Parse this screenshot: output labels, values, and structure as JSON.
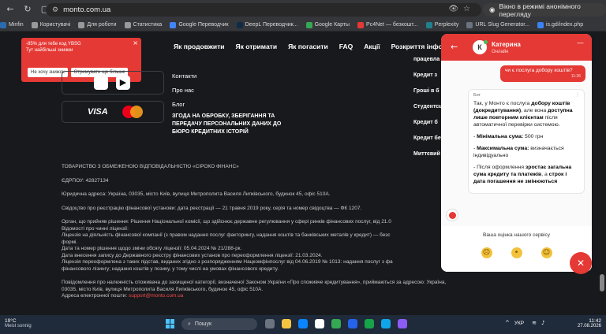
{
  "browser": {
    "url": "monto.com.ua",
    "incognito_label": "Вікно в режимі анонімного перегляду"
  },
  "bookmarks": [
    {
      "label": "Minfin",
      "color": "#2b6cb0"
    },
    {
      "label": "Користувачі",
      "color": "#999999"
    },
    {
      "label": "Для роботи",
      "color": "#999999"
    },
    {
      "label": "Статистика",
      "color": "#999999"
    },
    {
      "label": "Google Переводчик",
      "color": "#4285f4"
    },
    {
      "label": "DeepL Переводчик...",
      "color": "#0f2b46"
    },
    {
      "label": "Google Карты",
      "color": "#34a853"
    },
    {
      "label": "Pc4Net — безкошт...",
      "color": "#e53935"
    },
    {
      "label": "Perplexity",
      "color": "#20808d"
    },
    {
      "label": "URL Slug Generator...",
      "color": "#6b7280"
    },
    {
      "label": "is.gd/index.php",
      "color": "#3b82f6"
    }
  ],
  "nav": {
    "links": [
      "Як продовжити",
      "Як отримати",
      "Як погасити",
      "FAQ",
      "Акції",
      "Розкриття інформації"
    ]
  },
  "promo": {
    "line1": "-85% для тебе код YBSG",
    "line2": "Тут найбільші знижки",
    "decline": "Не хочу знижок",
    "accept": "Отримувати ще більше"
  },
  "footer": {
    "mid_links": [
      "Контакти",
      "Про нас",
      "Блог"
    ],
    "data_policy": "ЗГОДА НА ОБРОБКУ, ЗБЕРІГАННЯ ТА ПЕРЕДАЧУ ПЕРСОНАЛЬНИХ ДАНИХ ДО БЮРО КРЕДИТНИХ ІСТОРІЙ",
    "right_links": [
      "працевла",
      "Кредит з",
      "Гроші в б",
      "Студентсь",
      "Кредит б",
      "Кредит бе",
      "Миттєвий"
    ],
    "visa": "VISA"
  },
  "legal": {
    "company": "ТОВАРИСТВО З ОБМЕЖЕНОЮ ВІДПОВІДАЛЬНІСТЮ «СІРОКО ФІНАНС»",
    "edrpou": "ЄДРПОУ: 42827134",
    "address": "Юридична адреса: Україна, 03035, місто Київ, вулиця Митрополита Василя Липківського, будинок 45, офіс 510А.",
    "certificate": "Свідоцтво про реєстрацію фінансової установи: дата реєстрації — 21 травня 2019 року, серія та номер свідоцтва — ФК 1207.",
    "regulator": "Орган, що прийняв рішення: Рішення Національної комісії, що здійснює державне регулювання у сфері ринків фінансових послуг, від 21.0",
    "license_info": "Відомості про чинні ліцензії:",
    "license": "Ліцензія на діяльність фінансової компанії (з правом надання послуг факторингу, надання коштів та банківських металів у кредит) — безс",
    "form": "формі.",
    "change_date": "Дата та номер рішення щодо зміни обсягу ліцензії: 05.04.2024 № 21/288-рк.",
    "register_date": "Дата внесення запису до Державного реєстру фінансових установ про переоформлення ліцензії: 21.03.2024.",
    "reissue": "Ліцензія переоформлена з таких підстав, виданих згідно з розпорядженням Нацкомфінпослуг від 04.06.2019 № 1013: надання послуг з фа",
    "reissue2": "фінансового лізингу; надання коштів у позику, у тому числі на умовах фінансового кредиту.",
    "notice": "Повідомлення про належність споживача до захищеної категорії, визначеної Законом України «Про споживче кредитування», приймаються за адресою: Україна,",
    "notice2": "03035, місто Київ, вулиця Митрополита Василя Липківського, будинок 45, офіс 510А.",
    "email_label": "Адреса електронної пошти: ",
    "email": "support@monto.com.ua"
  },
  "chat": {
    "agent_initial": "К",
    "agent_name": "Катерина",
    "status": "Онлайн",
    "user_message": "чи є послуга добору коштів?",
    "user_time": "11:36",
    "bot_label": "Бот",
    "bot_p1_a": "Так, у Монто є послуга ",
    "bot_p1_b": "добору коштів (докредитування)",
    "bot_p1_c": ", але вона ",
    "bot_p1_d": "доступна лише повторним клієнтам",
    "bot_p1_e": " після автоматичної перевірки системою.",
    "bot_p2_a": "- ",
    "bot_p2_b": "Мінімальна сума:",
    "bot_p2_c": " 500 грн",
    "bot_p3_a": "- ",
    "bot_p3_b": "Максимальна сума:",
    "bot_p3_c": " визначається індивідуально",
    "bot_p4_a": "- Після оформлення ",
    "bot_p4_b": "зростає загальна сума кредиту та платежів",
    "bot_p4_c": ", а ",
    "bot_p4_d": "строк і дата погашення не змінюються",
    "rating_question": "Ваша оцінка нашого сервісу"
  },
  "taskbar": {
    "temperature": "19°C",
    "weather": "Meist sonnig",
    "search": "Пошук",
    "lang": "УКР",
    "time": "11:42",
    "date": "27.08.2026"
  }
}
